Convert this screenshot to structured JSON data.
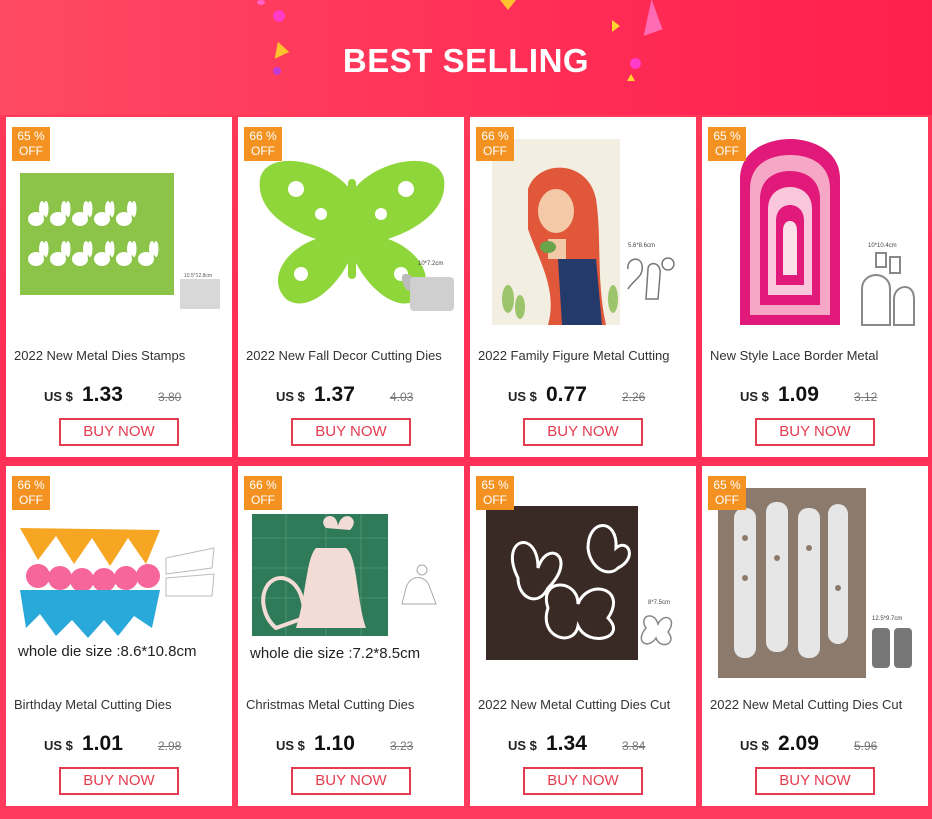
{
  "header": {
    "title": "BEST SELLING"
  },
  "products": [
    {
      "discount": "65 %",
      "off": "OFF",
      "name": "2022 New Metal Dies Stamps",
      "currency": "US $",
      "price": "1.33",
      "old_price": "3.80",
      "buy": "BUY NOW",
      "size_label": "10.5*12.8cm",
      "icon": "easter-bunny-die-icon"
    },
    {
      "discount": "66 %",
      "off": "OFF",
      "name": "2022 New Fall Decor Cutting Dies",
      "currency": "US $",
      "price": "1.37",
      "old_price": "4.03",
      "buy": "BUY NOW",
      "size_label": "10*7.2cm",
      "icon": "butterfly-die-icon"
    },
    {
      "discount": "66 %",
      "off": "OFF",
      "name": "2022 Family Figure Metal Cutting",
      "currency": "US $",
      "price": "0.77",
      "old_price": "2.26",
      "buy": "BUY NOW",
      "size_label": "5.6*8.6cm",
      "icon": "woman-figure-die-icon"
    },
    {
      "discount": "65 %",
      "off": "OFF",
      "name": "New Style Lace Border Metal",
      "currency": "US $",
      "price": "1.09",
      "old_price": "3.12",
      "buy": "BUY NOW",
      "size_label": "10*10.4cm",
      "icon": "lace-border-die-icon"
    },
    {
      "discount": "66 %",
      "off": "OFF",
      "name": "Birthday Metal Cutting Dies",
      "currency": "US $",
      "price": "1.01",
      "old_price": "2.98",
      "buy": "BUY NOW",
      "caption": "whole die size :8.6*10.8cm",
      "icon": "bunting-die-icon"
    },
    {
      "discount": "66 %",
      "off": "OFF",
      "name": "Christmas Metal Cutting Dies",
      "currency": "US $",
      "price": "1.10",
      "old_price": "3.23",
      "buy": "BUY NOW",
      "caption": "whole die size :7.2*8.5cm",
      "icon": "christmas-bell-die-icon"
    },
    {
      "discount": "65 %",
      "off": "OFF",
      "name": "2022 New Metal Cutting Dies Cut",
      "currency": "US $",
      "price": "1.34",
      "old_price": "3.84",
      "buy": "BUY NOW",
      "size_label": "8*7.5cm",
      "icon": "butterflies-die-icon"
    },
    {
      "discount": "65 %",
      "off": "OFF",
      "name": "2022 New Metal Cutting Dies Cut",
      "currency": "US $",
      "price": "2.09",
      "old_price": "5.96",
      "buy": "BUY NOW",
      "size_label": "12.5*9.7cm",
      "icon": "flower-border-die-icon"
    }
  ],
  "colors": {
    "accent": "#e53b4f",
    "badge": "#f39220",
    "background": "#ff2e55"
  }
}
